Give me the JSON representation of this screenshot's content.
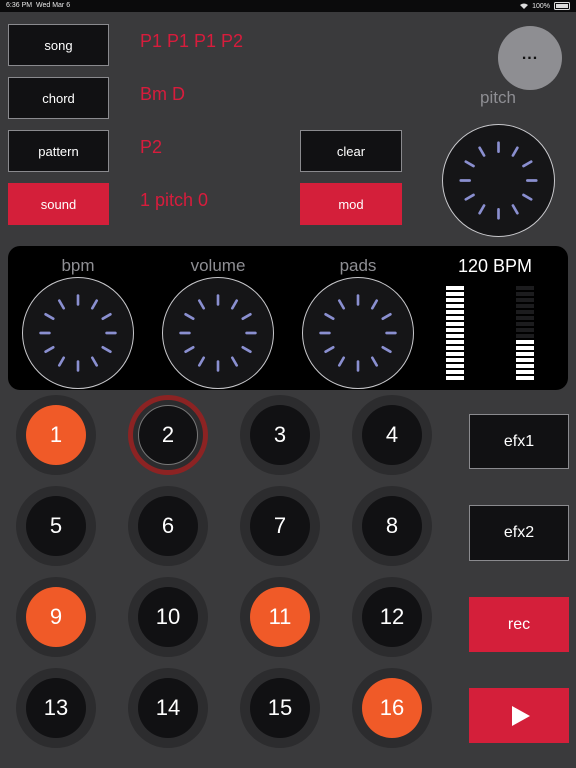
{
  "status": {
    "time": "6:36 PM",
    "date": "Wed Mar 6",
    "battery": "100%"
  },
  "menu": {
    "song": "song",
    "chord": "chord",
    "pattern": "pattern",
    "sound": "sound",
    "clear": "clear",
    "mod": "mod"
  },
  "info": {
    "song_value": "P1 P1 P1 P2",
    "chord_value": "Bm D",
    "pattern_value": "P2",
    "sound_value": "1 pitch 0"
  },
  "more_label": "...",
  "knobs": {
    "pitch": "pitch",
    "bpm": "bpm",
    "volume": "volume",
    "pads": "pads"
  },
  "bpm_readout": "120 BPM",
  "meters": {
    "left_level": 1.0,
    "right_level": 0.45
  },
  "pads": [
    {
      "label": "1",
      "active": true
    },
    {
      "label": "2",
      "active": false,
      "selected": true
    },
    {
      "label": "3",
      "active": false
    },
    {
      "label": "4",
      "active": false
    },
    {
      "label": "5",
      "active": false
    },
    {
      "label": "6",
      "active": false
    },
    {
      "label": "7",
      "active": false
    },
    {
      "label": "8",
      "active": false
    },
    {
      "label": "9",
      "active": true
    },
    {
      "label": "10",
      "active": false
    },
    {
      "label": "11",
      "active": true
    },
    {
      "label": "12",
      "active": false
    },
    {
      "label": "13",
      "active": false
    },
    {
      "label": "14",
      "active": false
    },
    {
      "label": "15",
      "active": false
    },
    {
      "label": "16",
      "active": true
    }
  ],
  "side": {
    "efx1": "efx1",
    "efx2": "efx2",
    "rec": "rec"
  },
  "icons": {
    "more": "more-icon",
    "play": "play-icon"
  },
  "colors": {
    "accent_red": "#d41f3a",
    "pad_orange": "#f05a28",
    "text_red": "#d81c3c"
  }
}
